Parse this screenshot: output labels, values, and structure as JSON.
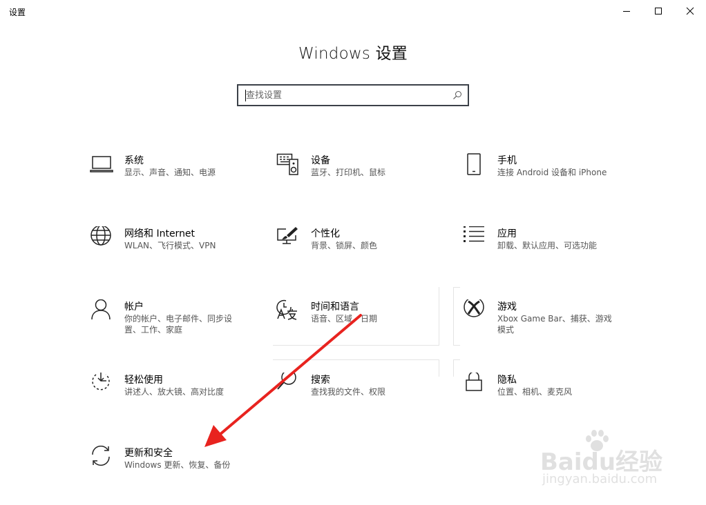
{
  "window": {
    "title": "设置",
    "controls": [
      "minimize",
      "maximize",
      "close"
    ]
  },
  "page": {
    "title": "Windows 设置"
  },
  "search": {
    "placeholder": "查找设置",
    "value": ""
  },
  "tiles": [
    {
      "name": "系统",
      "desc": "显示、声音、通知、电源",
      "icon": "laptop-icon"
    },
    {
      "name": "设备",
      "desc": "蓝牙、打印机、鼠标",
      "icon": "devices-icon"
    },
    {
      "name": "手机",
      "desc": "连接 Android 设备和 iPhone",
      "icon": "phone-icon"
    },
    {
      "name": "网络和 Internet",
      "desc": "WLAN、飞行模式、VPN",
      "icon": "globe-icon"
    },
    {
      "name": "个性化",
      "desc": "背景、锁屏、颜色",
      "icon": "personalization-icon"
    },
    {
      "name": "应用",
      "desc": "卸载、默认应用、可选功能",
      "icon": "apps-list-icon"
    },
    {
      "name": "帐户",
      "desc": "你的帐户、电子邮件、同步设置、工作、家庭",
      "icon": "person-icon"
    },
    {
      "name": "时间和语言",
      "desc": "语音、区域、日期",
      "icon": "time-language-icon"
    },
    {
      "name": "游戏",
      "desc": "Xbox Game Bar、捕获、游戏模式",
      "icon": "xbox-icon"
    },
    {
      "name": "轻松使用",
      "desc": "讲述人、放大镜、高对比度",
      "icon": "ease-of-access-icon"
    },
    {
      "name": "搜索",
      "desc": "查找我的文件、权限",
      "icon": "search-magnifier-icon"
    },
    {
      "name": "隐私",
      "desc": "位置、相机、麦克风",
      "icon": "lock-icon"
    },
    {
      "name": "更新和安全",
      "desc": "Windows 更新、恢复、备份",
      "icon": "refresh-icon"
    }
  ],
  "annotation": {
    "arrow_color": "#e8231f"
  },
  "watermark": {
    "brand": "Baidu经验",
    "url": "jingyan.baidu.com"
  }
}
